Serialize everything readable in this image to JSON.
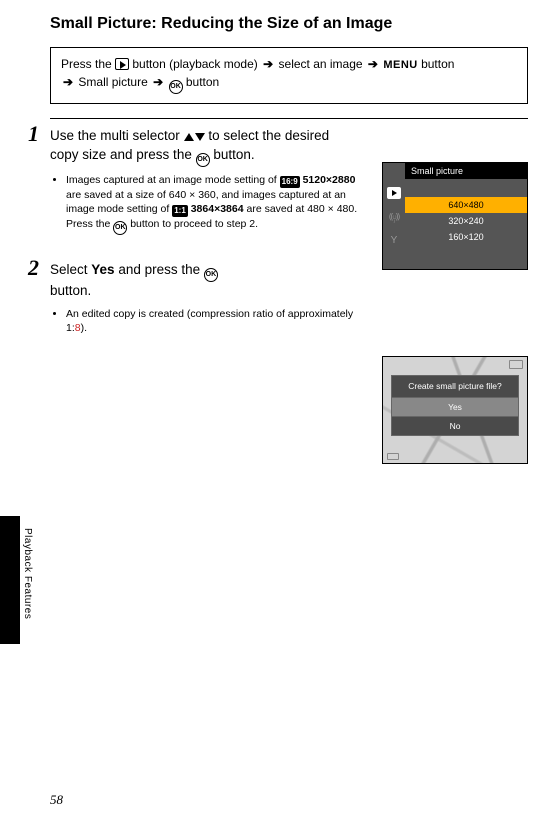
{
  "page_number": "58",
  "section_tab": "Playback Features",
  "title": "Small Picture: Reducing the Size of an Image",
  "intro": {
    "p1a": "Press the ",
    "p1b": " button (playback mode) ",
    "p1c": " select an image ",
    "p1d": " button",
    "p2a": " Small picture ",
    "p2b": " button",
    "menu_word": "MENU"
  },
  "step1": {
    "num": "1",
    "head_a": "Use the multi selector ",
    "head_b": " to select the desired copy size and press the ",
    "head_c": " button.",
    "bullet_a": "Images captured at an image mode setting of ",
    "mode1_label": "16:9",
    "mode1_res": "5120×2880",
    "bullet_b": " are saved at a size of 640 × 360, and images captured at an image mode setting of ",
    "mode2_label": "1:1",
    "mode2_res": "3864×3864",
    "bullet_c": " are saved at 480 × 480. Press the ",
    "bullet_d": " button to proceed to step 2."
  },
  "step2": {
    "num": "2",
    "head_a": "Select ",
    "head_yes": "Yes",
    "head_b": " and press the ",
    "head_c": " button.",
    "bullet_a": "An edited copy is created (compression ratio of approximately 1:",
    "bullet_8": "8",
    "bullet_b": ")."
  },
  "screen1": {
    "title": "Small picture",
    "opt1": "640×480",
    "opt2": "320×240",
    "opt3": "160×120"
  },
  "screen2": {
    "title": "Create small picture file?",
    "yes": "Yes",
    "no": "No"
  }
}
